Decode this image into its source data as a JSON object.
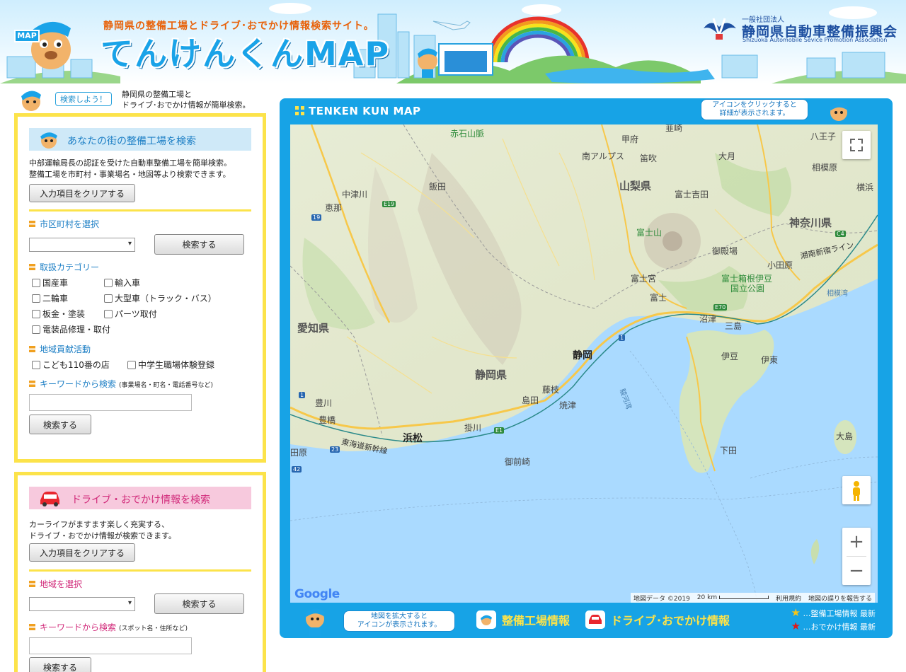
{
  "header": {
    "tagline": "静岡県の整備工場とドライブ･おでかけ情報検索サイト。",
    "site_title": "てんけんくんMAP",
    "mascot_sign": "MAP",
    "org_prefix": "一般社団法人",
    "org_name": "静岡県自動車整備振興会",
    "org_name_en": "Shizuoka Automobile Sevice Promotion Association"
  },
  "intro": {
    "badge": "検索しよう！",
    "line1": "静岡県の整備工場と",
    "line2": "ドライブ･おでかけ情報が簡単検索。"
  },
  "garage_search": {
    "heading": "あなたの街の整備工場を検索",
    "desc1": "中部運輸局長の認証を受けた自動車整備工場を簡単検索。",
    "desc2": "整備工場を市町村・事業場名・地図等より検索できます。",
    "clear_button": "入力項目をクリアする",
    "city_label": "市区町村を選択",
    "city_value": "",
    "search_button": "検索する",
    "category_label": "取扱カテゴリー",
    "categories": [
      "国産車",
      "輸入車",
      "二輪車",
      "大型車（トラック・バス）",
      "板金・塗装",
      "パーツ取付",
      "電装品修理・取付"
    ],
    "community_label": "地域貢献活動",
    "community": [
      "こども110番の店",
      "中学生職場体験登録"
    ],
    "keyword_label": "キーワードから検索",
    "keyword_note": "(事業場名・町名・電話番号など)",
    "keyword_value": "",
    "keyword_button": "検索する"
  },
  "drive_search": {
    "heading": "ドライブ・おでかけ情報を検索",
    "desc1": "カーライフがますます楽しく充実する、",
    "desc2": "ドライブ・おでかけ情報が検索できます。",
    "clear_button": "入力項目をクリアする",
    "area_label": "地域を選択",
    "area_value": "",
    "search_button": "検索する",
    "keyword_label": "キーワードから検索",
    "keyword_note": "(スポット名・住所など)",
    "keyword_value": "",
    "keyword_button": "検索する"
  },
  "map_panel": {
    "title": "TENKEN KUN MAP",
    "hint_top": [
      "アイコンをクリックすると",
      "詳細が表示されます。"
    ],
    "hint_bottom": [
      "地図を拡大すると",
      "アイコンが表示されます。"
    ],
    "legend_garage": "整備工場情報",
    "legend_drive": "ドライブ･おでかけ情報",
    "star_garage": "…整備工場情報 最新",
    "star_drive": "…おでかけ情報 最新",
    "star_garage_color": "#f5c518",
    "star_drive_color": "#e01818"
  },
  "map": {
    "labels": {
      "akaishi": "赤石山脈",
      "kofu": "甲府",
      "nirasaki": "韮崎",
      "hachioji": "八王子",
      "minami_alps": "南アルプス",
      "fuefuki": "笛吹",
      "otsuki": "大月",
      "sagamihara": "相模原",
      "nakatsugawa": "中津川",
      "iida": "飯田",
      "yamanashi": "山梨県",
      "fujiyoshida": "富士吉田",
      "yokohama": "横浜",
      "ena": "恵那",
      "fujisan": "富士山",
      "kanagawa": "神奈川県",
      "gotemba": "御殿場",
      "odawara": "小田原",
      "shonan": "湘南新宿ライン",
      "fujinomiya": "富士宮",
      "hakone": "富士箱根伊豆",
      "hakone2": "国立公園",
      "sagamiwan": "相模湾",
      "fuji": "富士",
      "numazu": "沼津",
      "mishima": "三島",
      "aichi": "愛知県",
      "shizuoka": "静岡",
      "izu": "伊豆",
      "ito": "伊東",
      "shizuoka_pref": "静岡県",
      "fujieda": "藤枝",
      "shimada": "島田",
      "yaizu": "焼津",
      "surugawan": "駿河湾",
      "toyokawa": "豊川",
      "toyohashi": "豊橋",
      "kakegawa": "掛川",
      "hamamatsu": "浜松",
      "oshima": "大島",
      "tahara": "田原",
      "shinkansen": "東海道新幹線",
      "shimoda": "下田",
      "omaezaki": "御前崎"
    },
    "shields": {
      "e19": "E19",
      "r19": "19",
      "c4": "C4",
      "e70": "E70",
      "r1a": "1",
      "r1b": "1",
      "e1": "E1",
      "r23": "23",
      "r42": "42"
    },
    "attribution_data": "地図データ ©2019",
    "scale": "20 km",
    "terms": "利用規約",
    "report": "地図の誤りを報告する",
    "google": "Google",
    "zoom_in": "+",
    "zoom_out": "−"
  }
}
